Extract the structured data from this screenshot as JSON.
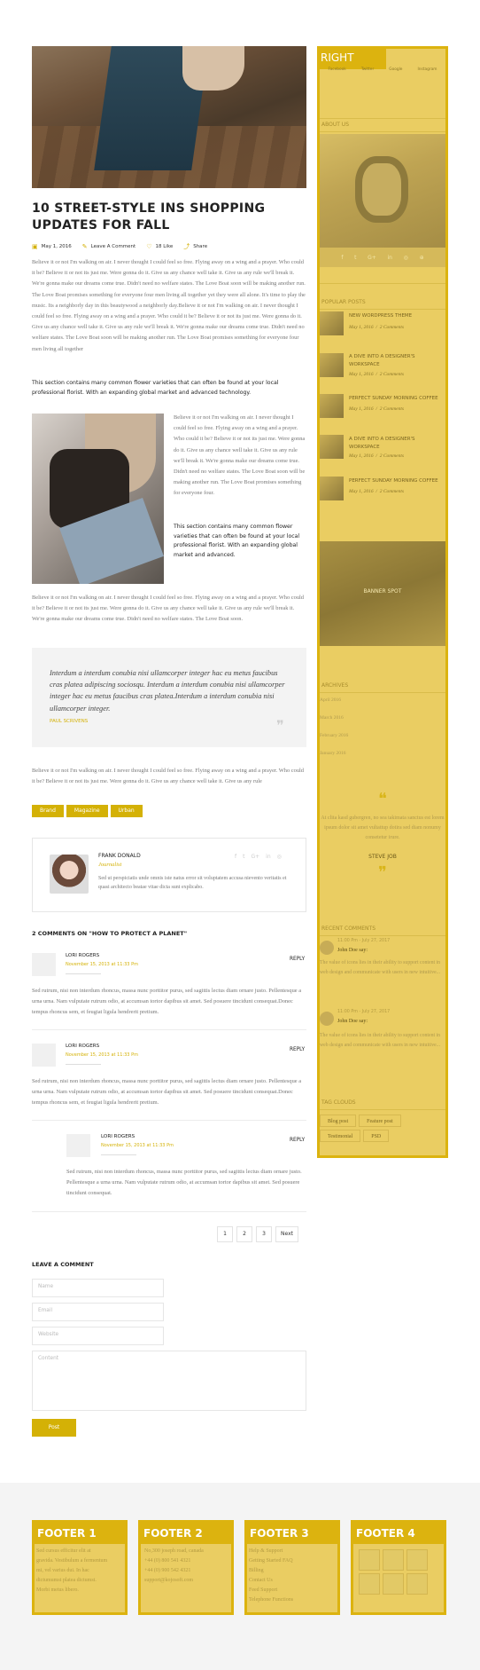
{
  "post": {
    "title": "10 Street-style INS Shopping Updates for Fall",
    "meta": {
      "date": "May 1, 2016",
      "comment": "Leave A Comment",
      "likes": "18 Like",
      "share": "Share"
    },
    "para1": "Believe it or not I'm walking on air. I never thought I could feel so free. Flying away on a wing and a prayer. Who could it be? Believe it or not its just me. Were gonna do it. Give us any chance well take it. Give us any rule we'll break it. We're gonna make our dreams come true. Didn't need no welfare states. The Love Boat soon will be making another run. The Love Boat promises something for everyone four men living all together yet they were all alone. It's time to play the music. Its a neighborly day in this beautywood a neighborly day.Believe it or not I'm walking on air. I never thought I could feel so free. Flying away on a wing and a prayer. Who could it be? Believe it or not its just me. Were gonna do it. Give us any chance well take it. Give us any rule we'll break it. We're gonna make our dreams come true. Didn't need no welfare states. The Love Boat soon will be making another run. The Love Boat promises something for everyone four men living all together",
    "bold1": "This section contains many common flower varieties that can often be found at your local professional florist. With an expanding global market and advanced technology.",
    "para2": "Believe it or not I'm walking on air. I never thought I could feel so free. Flying away on a wing and a prayer. Who could it be? Believe it or not its just me. Were gonna do it. Give us any chance well take it. Give us any rule we'll break it. We're gonna make our dreams come true. Didn't need no welfare states. The Love Boat soon will be making another run. The Love Boat promises something for everyone four.",
    "bold2": "This section contains many common flower varieties that can often be found at your local professional florist. With an expanding global market and advanced.",
    "para3": "Believe it or not I'm walking on air. I never thought I could feel so free. Flying away on a wing and a prayer. Who could it be? Believe it or not its just me. Were gonna do it. Give us any chance well take it. Give us any rule we'll break it. We're gonna make our dreams come true. Didn't need no welfare states. The Love Boat soon.",
    "quote": "Interdum a interdum conubia nisi ullamcorper integer hac eu metus faucibus cras platea adipiscing sociosqu. Interdum a interdum conubia nisi ullamcorper integer hac eu metus faucibus cras platea.Interdum a interdum conubia nisi ullamcorper integer.",
    "quote_author": "Paul Scrivens",
    "para4": "Believe it or not I'm walking on air. I never thought I could feel so free. Flying away on a wing and a prayer. Who could it be? Believe it or not its just me. Were gonna do it. Give us any chance well take it. Give us any rule",
    "tags": [
      "Brand",
      "Magazine",
      "Urban"
    ]
  },
  "author": {
    "name": "Frank Donald",
    "role": "Journalist",
    "bio": "Sed ut perspiciatis unde omnis iste natus error sit voluptatem accusa nievento veritatis et quasi architecto beatae vitae dicta sunt explicabo.",
    "social": [
      "f",
      "t",
      "G+",
      "in",
      "◎"
    ]
  },
  "comments": {
    "title": "2 Comments on \"How to protect a planet\"",
    "reply_label": "Reply",
    "items": [
      {
        "name": "Lori Rogers",
        "date": "November 15, 2013 at 11:33 Pm",
        "text": "Sed rutrum, nisi non interdum rhoncus, massa nunc porttitor purus, sed sagittis lectus diam ornare justo. Pellentesque a urna urna. Nam vulputate rutrum odio, at accumsan tortor dapibus sit amet. Sed posuere tincidunt consequat.Donec tempus rhoncus sem, et feugiat ligula hendrerit pretium."
      },
      {
        "name": "Lori Rogers",
        "date": "November 15, 2013 at 11:33 Pm",
        "text": "Sed rutrum, nisi non interdum rhoncus, massa nunc porttitor purus, sed sagittis lectus diam ornare justo. Pellentesque a urna urna. Nam vulputate rutrum odio, at accumsan tortor dapibus sit amet. Sed posuere tincidunt consequat.Donec tempus rhoncus sem, et feugiat ligula hendrerit pretium."
      },
      {
        "name": "Lori Rogers",
        "date": "November 15, 2013 at 11:33 Pm",
        "text": "Sed rutrum, nisi non interdum rhoncus, massa nunc porttitor purus, sed sagittis lectus diam ornare justo. Pellentesque a urna urna. Nam vulputate rutrum odio, at accumsan tortor dapibus sit amet. Sed posuere tincidunt consequat."
      }
    ]
  },
  "pagination": [
    "1",
    "2",
    "3",
    "Next"
  ],
  "form": {
    "title": "Leave a Comment",
    "name_placeholder": "Name",
    "email_placeholder": "Email",
    "website_placeholder": "Website",
    "content_placeholder": "Content",
    "submit": "Post"
  },
  "sidebar": {
    "label": "RIGHT",
    "social": [
      "Facebook",
      "Twitter",
      "Google",
      "Instagram"
    ],
    "about_title": "About Us",
    "about_social": [
      "f",
      "t",
      "G+",
      "in",
      "◎",
      "⊕"
    ],
    "popular_title": "Popular Posts",
    "popular": [
      {
        "title": "New WordPress theme",
        "date": "May 1, 2016",
        "comments": "2 Comments"
      },
      {
        "title": "A dive into a designer's workspace",
        "date": "May 1, 2016",
        "comments": "2 Comments"
      },
      {
        "title": "Perfect Sunday morning coffee",
        "date": "May 1, 2016",
        "comments": "2 Comments"
      },
      {
        "title": "A dive into a designer's workspace",
        "date": "May 1, 2016",
        "comments": "2 Comments"
      },
      {
        "title": "Perfect Sunday morning coffee",
        "date": "May 1, 2016",
        "comments": "2 Comments"
      }
    ],
    "banner": "Banner Spot",
    "archives_title": "Archives",
    "archives": [
      "April 2016",
      "March 2016",
      "February 2016",
      "January 2016"
    ],
    "testimonial": "At clita kasd gubergren, no sea takimata sanctus est lorem ipsum dolor sit amet vultattup dotira sed diam nonumy consetetur irure.",
    "testimonial_name": "Steve Job",
    "recent_title": "Recent Comments",
    "recent": [
      {
        "date": "11:00 Pm - July 27, 2017",
        "name": "John Doe say:",
        "text": "The value of icons lies in their ability to support content in web design and communicate with users in new intuitive..."
      },
      {
        "date": "11:00 Pm - July 27, 2017",
        "name": "John Doe say:",
        "text": "The value of icons lies in their ability to support content in web design and communicate with users in new intuitive..."
      }
    ],
    "tags_title": "Tag Clouds",
    "tags": [
      "Blog post",
      "Feature post",
      "Testimonial",
      "PSD"
    ]
  },
  "footer": {
    "cols": [
      {
        "label": "FOOTER 1",
        "lines": [
          "Sed cursus efficitur elit at",
          "gravida. Vestibulum a fermentum",
          "mi, vel varius dui. In hac",
          "dictumumst platea dictumst.",
          "Morbi metus libero."
        ]
      },
      {
        "label": "FOOTER 2",
        "lines": [
          "No,300 joseph road, canada",
          "+44 (0) 800 541 4321",
          "+44 (0) 900 542 4321",
          "support@kojosoft.com"
        ]
      },
      {
        "label": "FOOTER 3",
        "lines": [
          "Help & Support",
          "Getting Started FAQ",
          "Billing",
          "Contact Us",
          "Feed Support",
          "Telephone Functions"
        ]
      },
      {
        "label": "FOOTER 4",
        "lines": []
      }
    ]
  },
  "colors": {
    "accent": "#d4b106",
    "sidebar_fill": "#eacd62"
  }
}
